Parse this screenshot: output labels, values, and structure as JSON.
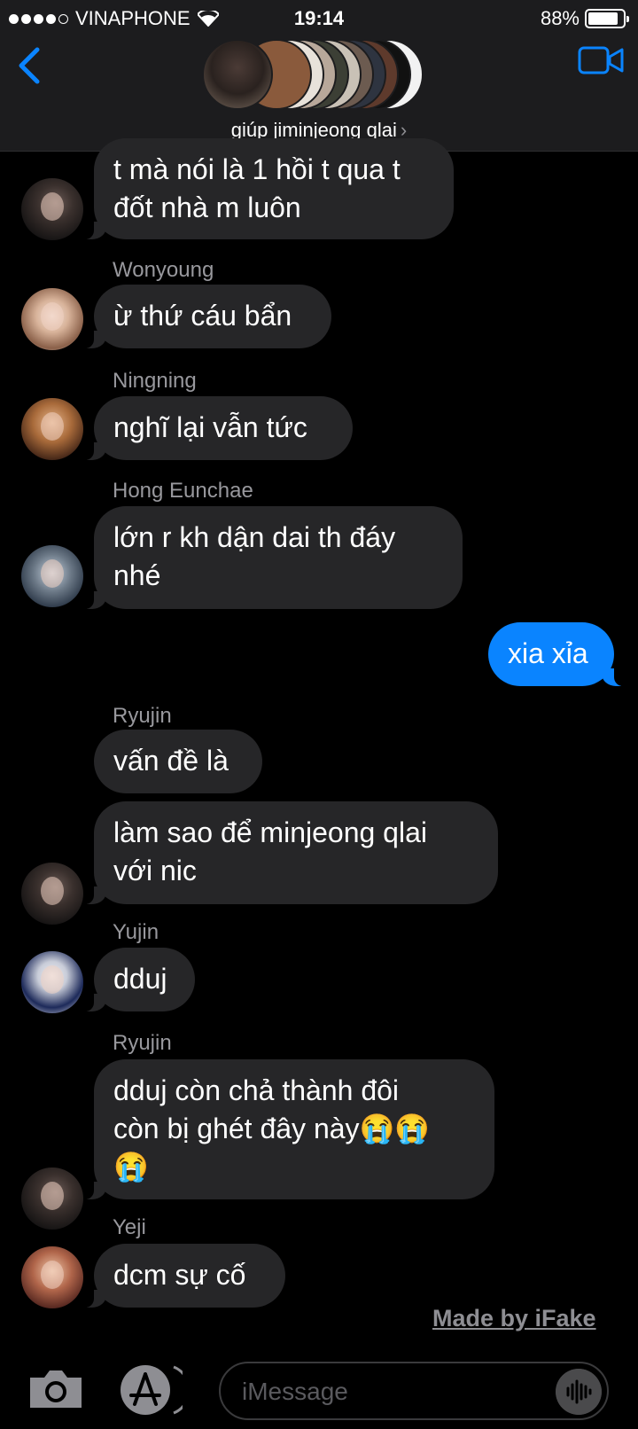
{
  "status_bar": {
    "carrier": "VINAPHONE",
    "time": "19:14",
    "battery": "88%",
    "battery_level": 0.88
  },
  "header": {
    "group_name": "giúp jiminjeong qlai",
    "chevron": "›"
  },
  "messages": [
    {
      "sender": "",
      "text": "t mà nói là 1 hồi t qua t\nđốt nhà m luôn",
      "direction": "in"
    },
    {
      "sender": "Wonyoung",
      "text": "ừ thứ cáu bẩn",
      "direction": "in"
    },
    {
      "sender": "Ningning",
      "text": "nghĩ lại vẫn tức",
      "direction": "in"
    },
    {
      "sender": "Hong Eunchae",
      "text": "lớn r kh dận dai th đáy\nnhé",
      "direction": "in"
    },
    {
      "sender": "",
      "text": "xia xỉa",
      "direction": "out"
    },
    {
      "sender": "Ryujin",
      "text": "vấn đề là",
      "direction": "in"
    },
    {
      "sender": "",
      "text": "làm sao để minjeong qlai\nvới nic",
      "direction": "in"
    },
    {
      "sender": "Yujin",
      "text": "dduj",
      "direction": "in"
    },
    {
      "sender": "Ryujin",
      "text": "dduj còn chả thành đôi\ncòn bị ghét đây này😭😭\n😭",
      "direction": "in"
    },
    {
      "sender": "Yeji",
      "text": "dcm sự cố",
      "direction": "in"
    }
  ],
  "watermark": "Made by iFake",
  "composer": {
    "placeholder": "iMessage"
  },
  "colors": {
    "accent": "#0a84ff",
    "incoming_bubble": "#262628",
    "header_bg": "#1c1c1e"
  },
  "icons": [
    "back-chevron-icon",
    "video-camera-icon",
    "camera-icon",
    "app-store-icon",
    "audio-waveform-icon",
    "wifi-icon"
  ]
}
